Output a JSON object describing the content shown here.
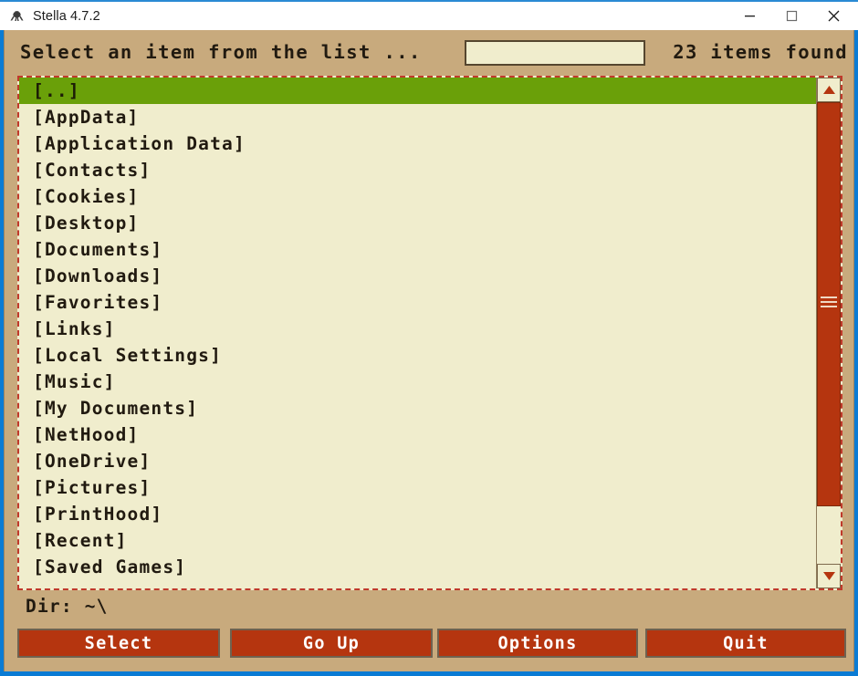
{
  "window": {
    "title": "Stella 4.7.2",
    "app_icon": "stella-icon",
    "controls": {
      "minimize": "minimize-icon",
      "maximize": "maximize-icon",
      "close": "close-icon"
    }
  },
  "header": {
    "prompt": "Select an item from the list ...",
    "filter_value": "",
    "filter_placeholder": "",
    "items_found": "23 items found"
  },
  "list": {
    "selected_index": 0,
    "items": [
      "[..]",
      "[AppData]",
      "[Application Data]",
      "[Contacts]",
      "[Cookies]",
      "[Desktop]",
      "[Documents]",
      "[Downloads]",
      "[Favorites]",
      "[Links]",
      "[Local Settings]",
      "[Music]",
      "[My Documents]",
      "[NetHood]",
      "[OneDrive]",
      "[Pictures]",
      "[PrintHood]",
      "[Recent]",
      "[Saved Games]"
    ]
  },
  "scrollbar": {
    "up_icon": "triangle-up-icon",
    "down_icon": "triangle-down-icon",
    "thumb": "scrollbar-thumb"
  },
  "status": {
    "dir_label": "Dir:  ~\\"
  },
  "buttons": {
    "select": "Select",
    "go_up": "Go Up",
    "options": "Options",
    "quit": "Quit"
  },
  "colors": {
    "chrome": "#c8aa7d",
    "list_bg": "#f0edcd",
    "selection": "#6aa009",
    "button": "#b5350f",
    "dashed_border": "#c0392b",
    "titlebar": "#ffffff",
    "window_edge": "#0a7bd4"
  }
}
